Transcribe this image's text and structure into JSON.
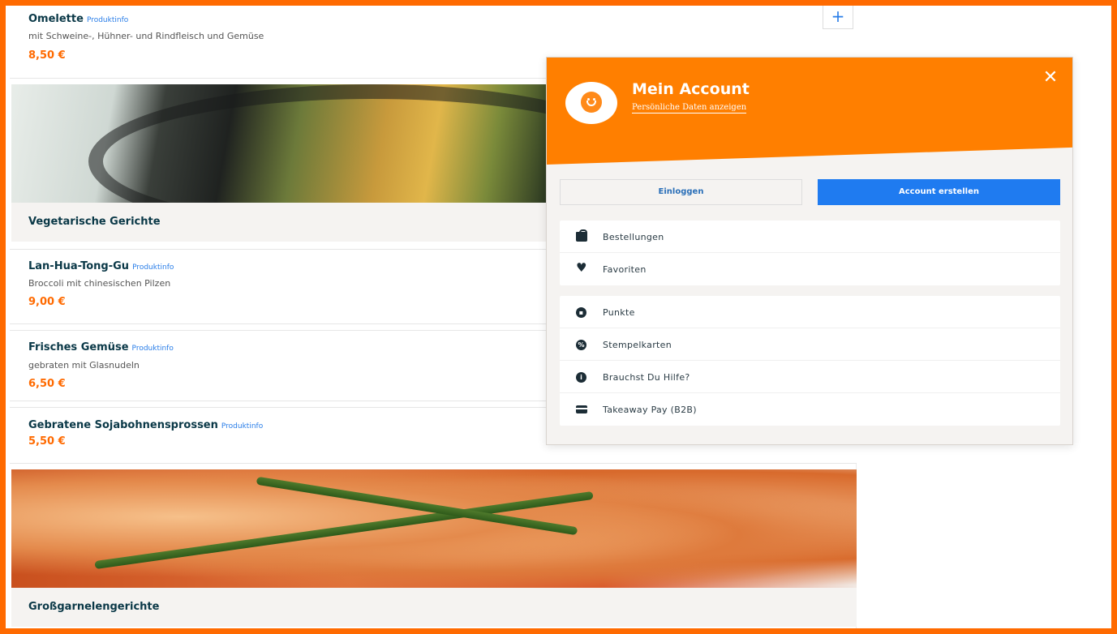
{
  "menu": {
    "add_button_label": "+",
    "items": [
      {
        "name": "Omelette",
        "info": "Produktinfo",
        "description": "mit Schweine-, Hühner- und Rindfleisch und Gemüse",
        "price": "8,50 €"
      },
      {
        "name": "Lan-Hua-Tong-Gu",
        "info": "Produktinfo",
        "description": "Broccoli mit chinesischen Pilzen",
        "price": "9,00 €"
      },
      {
        "name": "Frisches Gemüse",
        "info": "Produktinfo",
        "description": "gebraten mit Glasnudeln",
        "price": "6,50 €"
      },
      {
        "name": "Gebratene Sojabohnensprossen",
        "info": "Produktinfo",
        "description": "",
        "price": "5,50 €"
      }
    ],
    "categories": [
      {
        "title": "Vegetarische Gerichte"
      },
      {
        "title": "Großgarnelengerichte"
      }
    ]
  },
  "account": {
    "title": "Mein Account",
    "link": "Persönliche Daten anzeigen",
    "close_label": "✕",
    "login_label": "Einloggen",
    "create_label": "Account erstellen",
    "group1": [
      {
        "label": "Bestellungen",
        "icon": "shopping-bag-icon"
      },
      {
        "label": "Favoriten",
        "icon": "heart-icon"
      }
    ],
    "group2": [
      {
        "label": "Punkte",
        "icon": "points-icon"
      },
      {
        "label": "Stempelkarten",
        "icon": "percent-icon"
      },
      {
        "label": "Brauchst Du Hilfe?",
        "icon": "info-icon"
      },
      {
        "label": "Takeaway Pay (B2B)",
        "icon": "card-icon"
      }
    ]
  },
  "colors": {
    "accent_orange": "#ff7f00",
    "price_orange": "#ff6a00",
    "primary_blue": "#1f7bf0",
    "heading_navy": "#0a3847"
  }
}
